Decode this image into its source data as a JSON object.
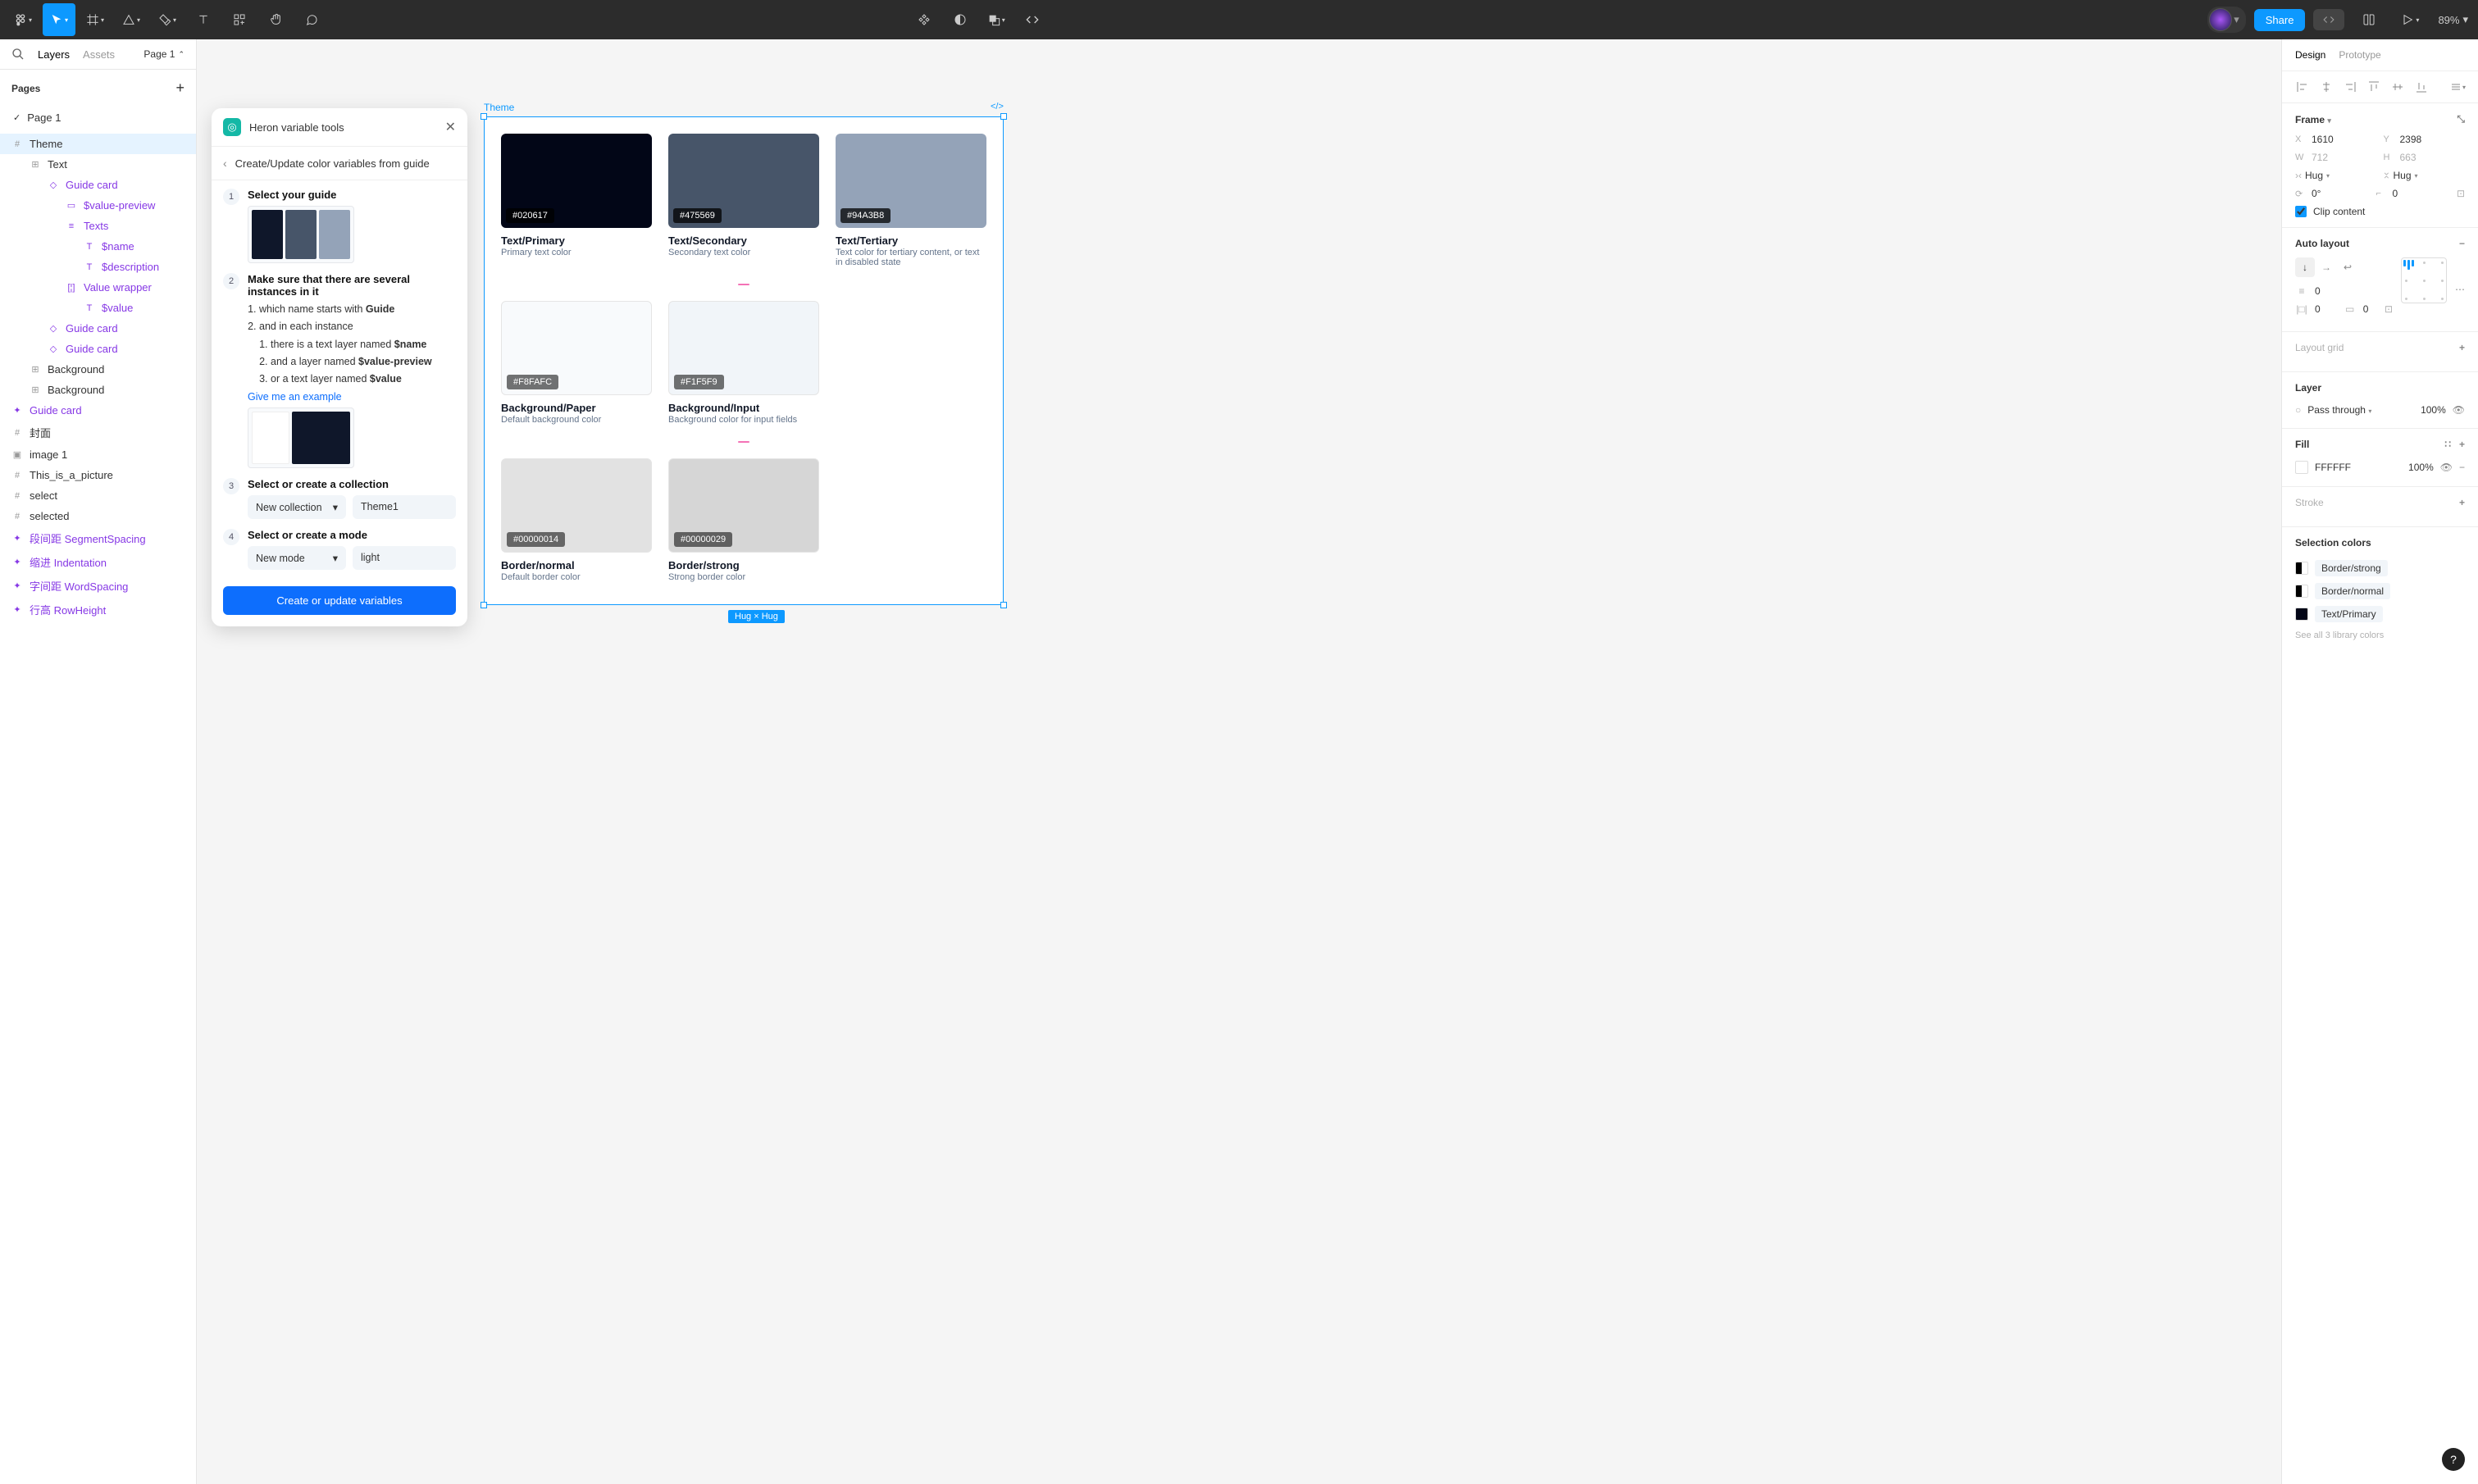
{
  "toolbar": {
    "share": "Share",
    "zoom": "89%"
  },
  "leftPanel": {
    "tabs": {
      "layers": "Layers",
      "assets": "Assets"
    },
    "pageSelector": "Page 1",
    "pagesHeader": "Pages",
    "pages": [
      "Page 1"
    ],
    "layers": [
      {
        "name": "Theme",
        "depth": 0,
        "icon": "frame",
        "selected": true
      },
      {
        "name": "Text",
        "depth": 1,
        "icon": "grid"
      },
      {
        "name": "Guide card",
        "depth": 2,
        "icon": "diamond",
        "purple": true
      },
      {
        "name": "$value-preview",
        "depth": 3,
        "icon": "rect",
        "purple": true
      },
      {
        "name": "Texts",
        "depth": 3,
        "icon": "lines",
        "purple": true
      },
      {
        "name": "$name",
        "depth": 4,
        "icon": "T",
        "purple": true
      },
      {
        "name": "$description",
        "depth": 4,
        "icon": "T",
        "purple": true
      },
      {
        "name": "Value wrapper",
        "depth": 3,
        "icon": "wrap",
        "purple": true
      },
      {
        "name": "$value",
        "depth": 4,
        "icon": "T",
        "purple": true
      },
      {
        "name": "Guide card",
        "depth": 2,
        "icon": "diamond",
        "purple": true
      },
      {
        "name": "Guide card",
        "depth": 2,
        "icon": "diamond",
        "purple": true
      },
      {
        "name": "Background",
        "depth": 1,
        "icon": "grid"
      },
      {
        "name": "Background",
        "depth": 1,
        "icon": "grid"
      },
      {
        "name": "Guide card",
        "depth": 0,
        "icon": "component",
        "purple": true
      },
      {
        "name": "封面",
        "depth": 0,
        "icon": "frame"
      },
      {
        "name": "image 1",
        "depth": 0,
        "icon": "image"
      },
      {
        "name": "This_is_a_picture",
        "depth": 0,
        "icon": "frame"
      },
      {
        "name": "select",
        "depth": 0,
        "icon": "frame"
      },
      {
        "name": "selected",
        "depth": 0,
        "icon": "frame"
      },
      {
        "name": "段间距 SegmentSpacing",
        "depth": 0,
        "icon": "component",
        "purple": true
      },
      {
        "name": "缩进 Indentation",
        "depth": 0,
        "icon": "component",
        "purple": true
      },
      {
        "name": "字间距 WordSpacing",
        "depth": 0,
        "icon": "component",
        "purple": true
      },
      {
        "name": "行高 RowHeight",
        "depth": 0,
        "icon": "component",
        "purple": true
      }
    ]
  },
  "plugin": {
    "title": "Heron variable tools",
    "subtitle": "Create/Update color variables from guide",
    "step1": "Select your guide",
    "step2": "Make sure that there are several instances in it",
    "step2_items": {
      "a": "which name starts with ",
      "a_bold": "Guide",
      "b": "and in each instance",
      "b1": "there is a text layer named ",
      "b1_bold": "$name",
      "b2": "and a layer named ",
      "b2_bold": "$value-preview",
      "b3": "or a text layer named ",
      "b3_bold": "$value"
    },
    "example": "Give me an example",
    "step3": "Select or create a collection",
    "collection_select": "New collection",
    "collection_value": "Theme1",
    "step4": "Select or create a mode",
    "mode_select": "New mode",
    "mode_value": "light",
    "submit": "Create or update variables"
  },
  "canvas": {
    "frameLabel": "Theme",
    "sizeBadge": "Hug × Hug",
    "cards": [
      {
        "color": "#020617",
        "hex": "#020617",
        "name": "Text/Primary",
        "desc": "Primary text color",
        "light": false
      },
      {
        "color": "#475569",
        "hex": "#475569",
        "name": "Text/Secondary",
        "desc": "Secondary text color",
        "light": false
      },
      {
        "color": "#94A3B8",
        "hex": "#94A3B8",
        "name": "Text/Tertiary",
        "desc": "Text color for tertiary content, or text in disabled state",
        "light": false
      },
      {
        "color": "#F8FAFC",
        "hex": "#F8FAFC",
        "name": "Background/Paper",
        "desc": "Default background color",
        "light": true
      },
      {
        "color": "#F1F5F9",
        "hex": "#F1F5F9",
        "name": "Background/Input",
        "desc": "Background color for input fields",
        "light": true
      },
      {
        "color": "#e2e2e2",
        "hex": "#00000014",
        "name": "Border/normal",
        "desc": "Default border color",
        "light": true
      },
      {
        "color": "#d6d6d6",
        "hex": "#00000029",
        "name": "Border/strong",
        "desc": "Strong border color",
        "light": true
      }
    ]
  },
  "rightPanel": {
    "tabs": {
      "design": "Design",
      "prototype": "Prototype"
    },
    "frame": {
      "title": "Frame",
      "x": "1610",
      "y": "2398",
      "w": "712",
      "h": "663",
      "hugW": "Hug",
      "hugH": "Hug",
      "rotation": "0°",
      "radius": "0",
      "clip": "Clip content"
    },
    "autolayout": {
      "title": "Auto layout",
      "gap": "0",
      "padH": "0",
      "padV": "0"
    },
    "layoutGrid": "Layout grid",
    "layer": {
      "title": "Layer",
      "blend": "Pass through",
      "opacity": "100%"
    },
    "fill": {
      "title": "Fill",
      "hex": "FFFFFF",
      "opacity": "100%"
    },
    "stroke": "Stroke",
    "selectionColors": {
      "title": "Selection colors",
      "items": [
        {
          "label": "Border/strong",
          "half": true
        },
        {
          "label": "Border/normal",
          "half": true
        },
        {
          "label": "Text/Primary",
          "color": "#020617"
        }
      ],
      "seeAll": "See all 3 library colors"
    }
  }
}
